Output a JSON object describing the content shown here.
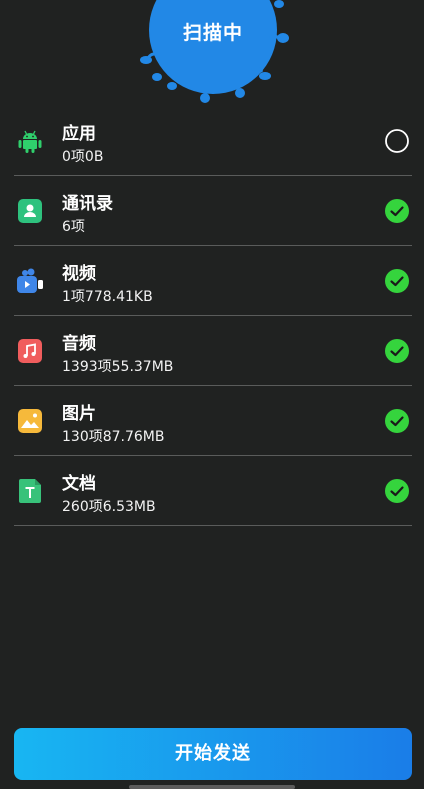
{
  "scan": {
    "label": "扫描中",
    "color": "#2288e6"
  },
  "items": [
    {
      "label": "应用",
      "sub": "0项0B",
      "icon": "android-icon",
      "icon_color": "#2fcf6c",
      "selected": false
    },
    {
      "label": "通讯录",
      "sub": "6项",
      "icon": "contacts-icon",
      "icon_color": "#2ec27e",
      "selected": true
    },
    {
      "label": "视频",
      "sub": "1项778.41KB",
      "icon": "video-icon",
      "icon_color": "#3f86e8",
      "selected": true
    },
    {
      "label": "音频",
      "sub": "1393项55.37MB",
      "icon": "music-icon",
      "icon_color": "#f05d5d",
      "selected": true
    },
    {
      "label": "图片",
      "sub": "130项87.76MB",
      "icon": "image-icon",
      "icon_color": "#f6b93b",
      "selected": true
    },
    {
      "label": "文档",
      "sub": "260项6.53MB",
      "icon": "document-icon",
      "icon_color": "#38c27a",
      "selected": true
    }
  ],
  "check_color": "#35d43d",
  "send_button": {
    "label": "开始发送"
  }
}
